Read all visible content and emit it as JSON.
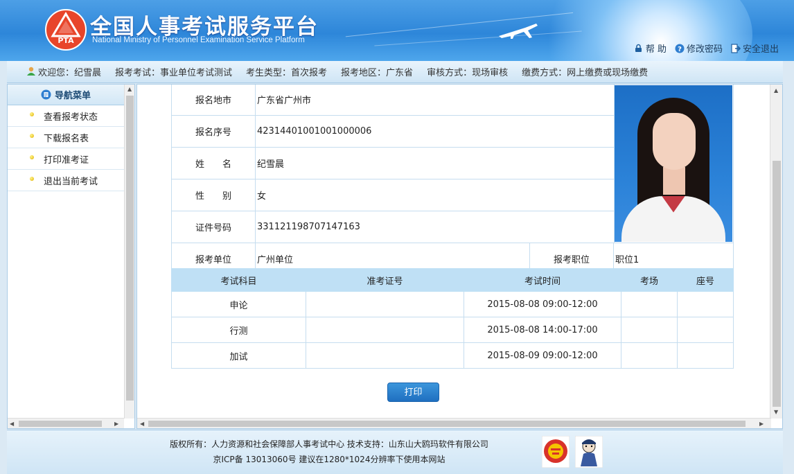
{
  "header": {
    "title": "全国人事考试服务平台",
    "subtitle": "National Ministry of Personnel Examination Service Platform",
    "logo_text": "PTA",
    "links": [
      {
        "label": "帮 助",
        "icon": "lock-icon"
      },
      {
        "label": "修改密码",
        "icon": "question-icon"
      },
      {
        "label": "安全退出",
        "icon": "logout-icon"
      }
    ]
  },
  "infobar": {
    "welcome": "欢迎您：纪雪晨",
    "exam": "报考考试：事业单位考试测试",
    "type": "考生类型：首次报考",
    "region": "报考地区：广东省",
    "review": "审核方式：现场审核",
    "payment": "缴费方式：网上缴费或现场缴费"
  },
  "nav": {
    "title": "导航菜单",
    "items": [
      "查看报考状态",
      "下载报名表",
      "打印准考证",
      "退出当前考试"
    ]
  },
  "info": {
    "rows": [
      {
        "label": "报名地市",
        "value": "广东省广州市"
      },
      {
        "label": "报名序号",
        "value": "42314401001001000006"
      },
      {
        "label": "姓　　名",
        "value": "纪雪晨"
      },
      {
        "label": "性　　别",
        "value": "女"
      },
      {
        "label": "证件号码",
        "value": "331121198707147163"
      }
    ],
    "unit_label": "报考单位",
    "unit_value": "广州单位",
    "position_label": "报考职位",
    "position_value": "职位1"
  },
  "scores": {
    "headers": [
      "考试科目",
      "准考证号",
      "考试时间",
      "考场",
      "座号"
    ],
    "rows": [
      {
        "subject": "申论",
        "ticket": "",
        "time": "2015-08-08 09:00-12:00",
        "room": "",
        "seat": ""
      },
      {
        "subject": "行测",
        "ticket": "",
        "time": "2015-08-08 14:00-17:00",
        "room": "",
        "seat": ""
      },
      {
        "subject": "加试",
        "ticket": "",
        "time": "2015-08-09 09:00-12:00",
        "room": "",
        "seat": ""
      }
    ]
  },
  "print_label": "打印",
  "footer": {
    "line1": "版权所有：人力资源和社会保障部人事考试中心  技术支持：山东山大鸥玛软件有限公司",
    "line2": "京ICP备 13013060号   建议在1280*1024分辨率下使用本网站"
  }
}
